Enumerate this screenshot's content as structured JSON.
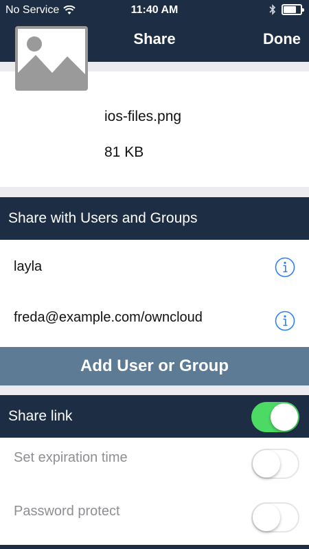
{
  "status": {
    "carrier": "No Service",
    "time": "11:40 AM"
  },
  "nav": {
    "title": "Share",
    "done_label": "Done"
  },
  "file": {
    "name": "ios-files.png",
    "size": "81 KB"
  },
  "share_users": {
    "header": "Share with Users and Groups",
    "users": [
      {
        "name": "layla"
      },
      {
        "name": "freda@example.com/owncloud"
      }
    ],
    "add_label": "Add User or Group"
  },
  "share_link": {
    "header": "Share link",
    "enabled": true,
    "options": [
      {
        "label": "Set expiration time",
        "enabled": false
      },
      {
        "label": "Password protect",
        "enabled": false
      }
    ]
  },
  "colors": {
    "nav": "#1d2d44",
    "add_button": "#5d7b95",
    "toggle_on": "#4cd964",
    "link": "#2a7fff"
  }
}
